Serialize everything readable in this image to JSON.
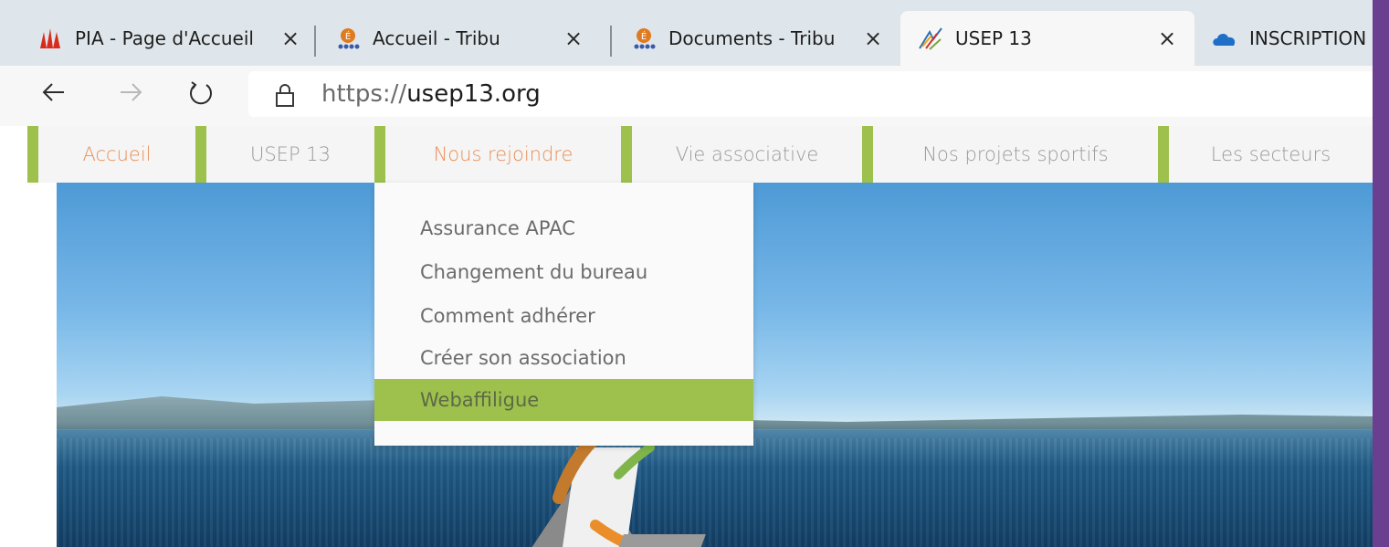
{
  "browser": {
    "tabs": [
      {
        "label": "PIA - Page d'Accueil",
        "icon": "pia-logo-icon",
        "icon_color": "#d92b1c",
        "active": false
      },
      {
        "label": "Accueil - Tribu",
        "icon": "tribu-logo-icon",
        "icon_color": "#e07a1f",
        "active": false
      },
      {
        "label": "Documents - Tribu",
        "icon": "tribu-logo-icon",
        "icon_color": "#e07a1f",
        "active": false
      },
      {
        "label": "USEP 13",
        "icon": "usep-logo-icon",
        "icon_color": "#2f6fb5",
        "active": true
      },
      {
        "label": "INSCRIPTION",
        "icon": "onedrive-cloud-icon",
        "icon_color": "#1e6fc8",
        "active": false
      }
    ],
    "close_glyph": "×",
    "address": {
      "scheme": "https://",
      "host": "usep13.org"
    }
  },
  "site": {
    "accent_green": "#9ec04d",
    "accent_orange": "#ea8e55",
    "nav": [
      {
        "label": "Accueil",
        "highlight": true
      },
      {
        "label": "USEP 13",
        "highlight": false
      },
      {
        "label": "Nous rejoindre",
        "highlight": true
      },
      {
        "label": "Vie associative",
        "highlight": false
      },
      {
        "label": "Nos projets sportifs",
        "highlight": false
      },
      {
        "label": "Les secteurs",
        "highlight": false
      }
    ],
    "dropdown": [
      {
        "label": "Assurance APAC",
        "selected": false
      },
      {
        "label": "Changement du bureau",
        "selected": false
      },
      {
        "label": "Comment adhérer",
        "selected": false
      },
      {
        "label": "Créer son association",
        "selected": false
      },
      {
        "label": "Webaffiligue",
        "selected": true
      }
    ]
  }
}
